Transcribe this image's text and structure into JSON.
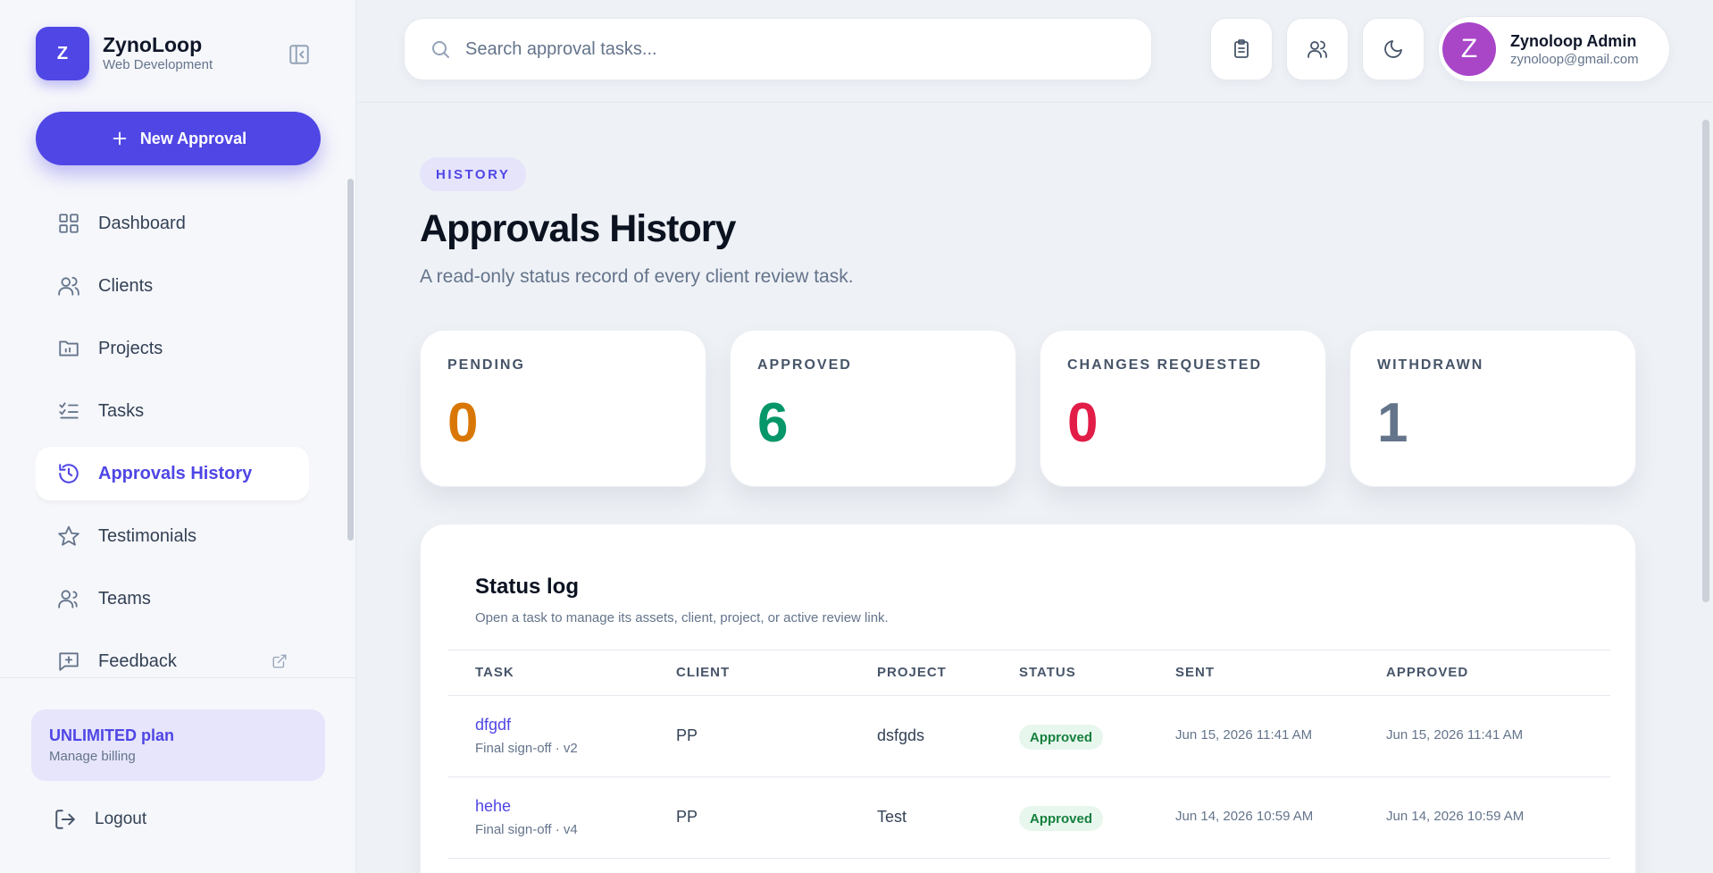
{
  "brand": {
    "initial": "Z",
    "name": "ZynoLoop",
    "subtitle": "Web Development"
  },
  "sidebar": {
    "new_button": "New Approval",
    "items": [
      {
        "label": "Dashboard",
        "icon": "grid-icon"
      },
      {
        "label": "Clients",
        "icon": "users-icon"
      },
      {
        "label": "Projects",
        "icon": "folder-icon"
      },
      {
        "label": "Tasks",
        "icon": "checklist-icon"
      },
      {
        "label": "Approvals History",
        "icon": "history-icon",
        "active": true
      },
      {
        "label": "Testimonials",
        "icon": "star-icon"
      },
      {
        "label": "Teams",
        "icon": "team-icon"
      },
      {
        "label": "Feedback",
        "icon": "message-plus-icon",
        "external": true
      }
    ],
    "plan": {
      "title": "UNLIMITED plan",
      "subtitle": "Manage billing"
    },
    "logout": "Logout"
  },
  "topbar": {
    "search_placeholder": "Search approval tasks...",
    "user": {
      "initial": "Z",
      "name": "Zynoloop Admin",
      "email": "zynoloop@gmail.com"
    }
  },
  "page": {
    "badge": "HISTORY",
    "title": "Approvals History",
    "subtitle": "A read-only status record of every client review task."
  },
  "stats": [
    {
      "label": "PENDING",
      "value": "0",
      "color": "#d97706"
    },
    {
      "label": "APPROVED",
      "value": "6",
      "color": "#059669"
    },
    {
      "label": "CHANGES REQUESTED",
      "value": "0",
      "color": "#e11d48"
    },
    {
      "label": "WITHDRAWN",
      "value": "1",
      "color": "#64748b"
    }
  ],
  "status_log": {
    "title": "Status log",
    "subtitle": "Open a task to manage its assets, client, project, or active review link.",
    "columns": [
      "TASK",
      "CLIENT",
      "PROJECT",
      "STATUS",
      "SENT",
      "APPROVED"
    ],
    "rows": [
      {
        "task": "dfgdf",
        "task_sub": "Final sign-off · v2",
        "client": "PP",
        "project": "dsfgds",
        "status": "Approved",
        "sent": "Jun 15, 2026 11:41 AM",
        "approved": "Jun 15, 2026 11:41 AM"
      },
      {
        "task": "hehe",
        "task_sub": "Final sign-off · v4",
        "client": "PP",
        "project": "Test",
        "status": "Approved",
        "sent": "Jun 14, 2026 10:59 AM",
        "approved": "Jun 14, 2026 10:59 AM"
      }
    ]
  }
}
